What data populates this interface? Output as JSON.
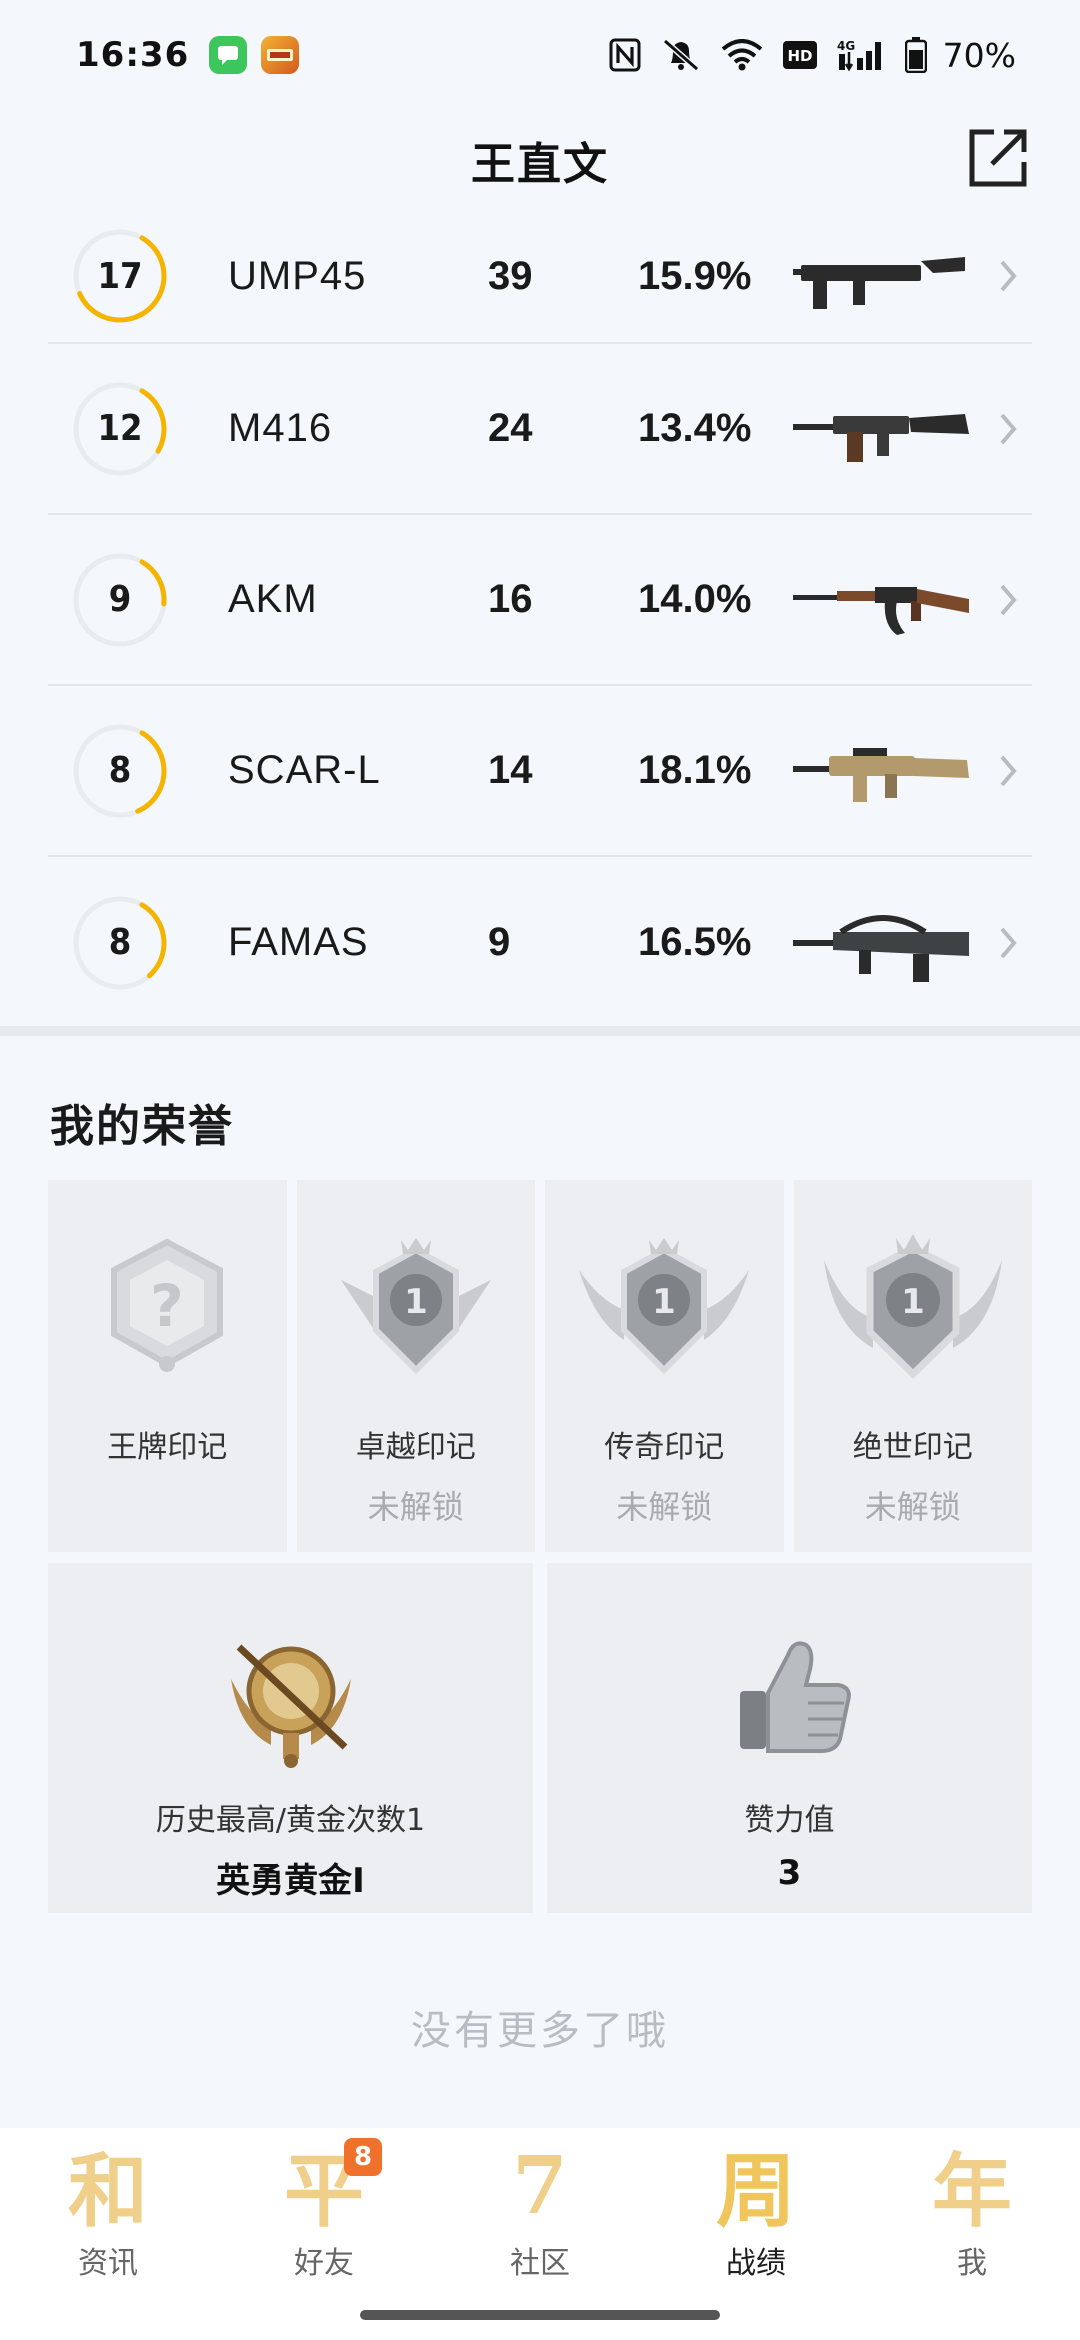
{
  "status_bar": {
    "time": "16:36",
    "battery": "70%",
    "icons": [
      "messages-app-icon",
      "game-app-icon",
      "nfc-icon",
      "mute-icon",
      "wifi-icon",
      "hd-icon",
      "signal-4g-icon",
      "battery-icon"
    ]
  },
  "header": {
    "title": "王直文",
    "share_icon": "share-external-icon"
  },
  "weapons": [
    {
      "rank_value": 17,
      "name": "UMP45",
      "kills": "39",
      "rate": "15.9%",
      "progress": 0.6,
      "image": "ump45-smg"
    },
    {
      "rank_value": 12,
      "name": "M416",
      "kills": "24",
      "rate": "13.4%",
      "progress": 0.25,
      "image": "m416-rifle"
    },
    {
      "rank_value": 9,
      "name": "AKM",
      "kills": "16",
      "rate": "14.0%",
      "progress": 0.18,
      "image": "akm-rifle"
    },
    {
      "rank_value": 8,
      "name": "SCAR-L",
      "kills": "14",
      "rate": "18.1%",
      "progress": 0.35,
      "image": "scar-l-rifle"
    },
    {
      "rank_value": 8,
      "name": "FAMAS",
      "kills": "9",
      "rate": "16.5%",
      "progress": 0.3,
      "image": "famas-rifle"
    }
  ],
  "honors": {
    "title": "我的荣誉",
    "cards": [
      {
        "label": "王牌印记",
        "lock": "",
        "icon": "question-shield-icon"
      },
      {
        "label": "卓越印记",
        "lock": "未解锁",
        "icon": "silver-badge-1-icon"
      },
      {
        "label": "传奇印记",
        "lock": "未解锁",
        "icon": "silver-winged-badge-icon"
      },
      {
        "label": "绝世印记",
        "lock": "未解锁",
        "icon": "silver-ornate-badge-icon"
      }
    ],
    "stats": [
      {
        "label": "历史最高/黄金次数1",
        "value": "英勇黄金I",
        "icon": "gold-tier-emblem-icon"
      },
      {
        "label": "赞力值",
        "value": "3",
        "icon": "thumbs-up-icon"
      }
    ]
  },
  "footer_text": "没有更多了哦",
  "nav": {
    "items": [
      {
        "glyph": "和",
        "label": "资讯",
        "active": false
      },
      {
        "glyph": "平",
        "label": "好友",
        "active": false,
        "badge": "8"
      },
      {
        "glyph": "7",
        "label": "社区",
        "active": false
      },
      {
        "glyph": "周",
        "label": "战绩",
        "active": true
      },
      {
        "glyph": "年",
        "label": "我",
        "active": false
      }
    ]
  },
  "colors": {
    "ring_progress": "#f5b400",
    "ring_track": "#e8ebef",
    "nav_gold": "#efcf8a",
    "badge": "#f0712c"
  }
}
